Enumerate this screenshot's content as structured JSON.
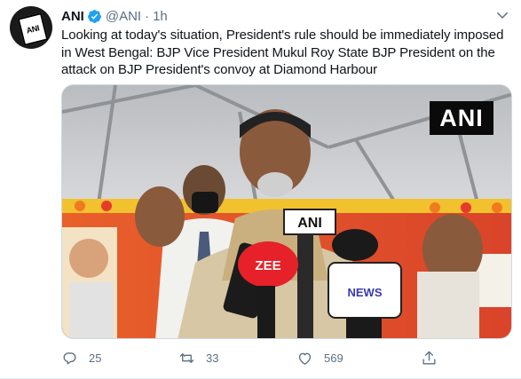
{
  "author": {
    "name": "ANI",
    "handle": "@ANI",
    "separator": "·",
    "time": "1h",
    "avatar_text": "ANI",
    "verified": true
  },
  "tweet": {
    "text": "Looking at today's situation, President's rule should be immediately imposed in West Bengal: BJP Vice President Mukul Roy State BJP President on the attack on BJP President's convoy at Diamond Harbour"
  },
  "media": {
    "watermark": "ANI",
    "mic_labels": {
      "ani": "ANI",
      "zee": "ZEE",
      "news": "NEWS"
    }
  },
  "actions": {
    "reply_count": "25",
    "retweet_count": "33",
    "like_count": "569"
  },
  "colors": {
    "accent": "#1da1f2",
    "muted": "#5b7083",
    "text": "#0f1419"
  },
  "icons": [
    "verified-badge-icon",
    "caret-down-icon",
    "reply-icon",
    "retweet-icon",
    "like-icon",
    "share-icon"
  ]
}
